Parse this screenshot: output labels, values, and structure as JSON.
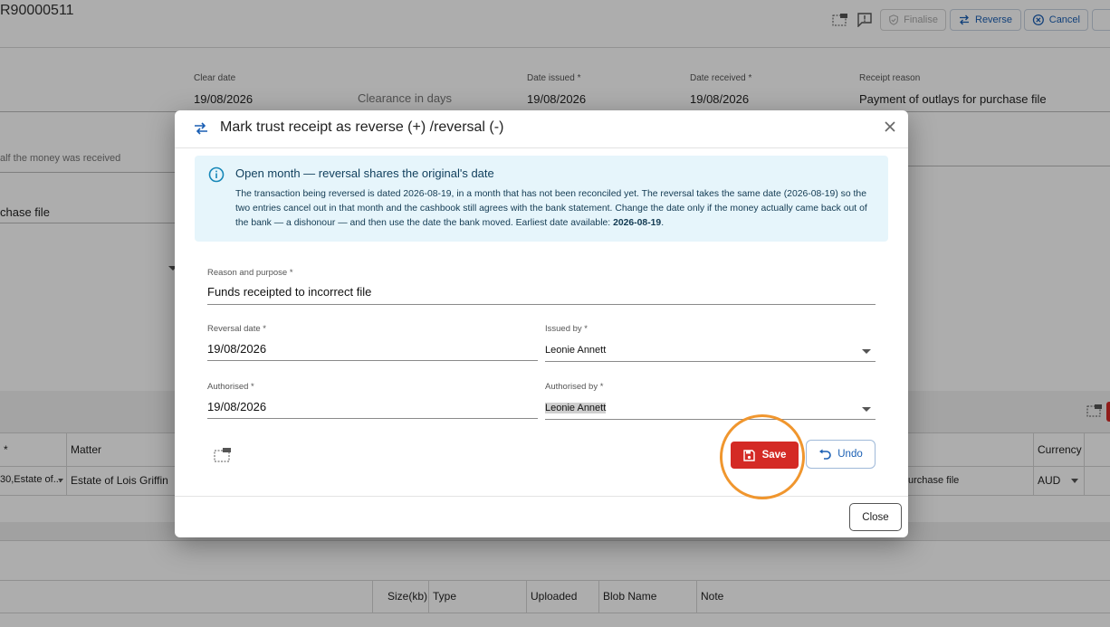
{
  "page": {
    "title": "R90000511",
    "toolbar": {
      "finalise": "Finalise",
      "reverse": "Reverse",
      "cancel": "Cancel"
    }
  },
  "form": {
    "clear_date": {
      "label": "Clear date",
      "value": "19/08/2026"
    },
    "clearance_in_days": {
      "placeholder": "Clearance in days"
    },
    "date_issued": {
      "label": "Date issued *",
      "value": "19/08/2026"
    },
    "date_received": {
      "label": "Date received *",
      "value": "19/08/2026"
    },
    "receipt_reason": {
      "label": "Receipt reason",
      "value": "Payment of outlays for purchase file"
    },
    "on_behalf": {
      "placeholder": "alf the money was received"
    },
    "purpose": {
      "value": "chase file"
    }
  },
  "grid": {
    "columns": [
      " *",
      "Matter",
      "Currency"
    ],
    "row": {
      "client": "30,Estate of...",
      "matter": "Estate of Lois Griffin",
      "reason": "urchase file",
      "currency": "AUD"
    }
  },
  "attachments": {
    "columns": [
      "Size(kb)",
      "Type",
      "Uploaded",
      "Blob Name",
      "Note"
    ]
  },
  "dialog": {
    "title": "Mark trust receipt as reverse (+) /reversal (-)",
    "info": {
      "title": "Open month — reversal shares the original's date",
      "body": "The transaction being reversed is dated 2026-08-19, in a month that has not been reconciled yet. The reversal takes the same date (2026-08-19) so the two entries cancel out in that month and the cashbook still agrees with the bank statement. Change the date only if the money actually came back out of the bank — a dishonour — and then use the date the bank moved. Earliest date available: ",
      "earliest": "2026-08-19",
      "end": "."
    },
    "reason": {
      "label": "Reason and purpose *",
      "value": "Funds receipted to incorrect file"
    },
    "reversal_date": {
      "label": "Reversal date *",
      "value": "19/08/2026"
    },
    "issued_by": {
      "label": "Issued by *",
      "value": "Leonie Annett"
    },
    "authorised": {
      "label": "Authorised *",
      "value": "19/08/2026"
    },
    "authorised_by": {
      "label": "Authorised by *",
      "value": "Leonie Annett"
    },
    "save_label": "Save",
    "undo_label": "Undo",
    "close_label": "Close"
  },
  "colors": {
    "primary": "#1a5fb4",
    "danger": "#d42a25",
    "info_bg": "#e6f5fb",
    "highlight_ring": "#f0962e"
  },
  "icons": [
    "reverse-arrows-icon",
    "close-icon",
    "info-icon",
    "save-disk-icon",
    "undo-arrow-icon",
    "layout-icon",
    "comment-alert-icon",
    "shield-check-icon",
    "cancel-circle-icon"
  ]
}
